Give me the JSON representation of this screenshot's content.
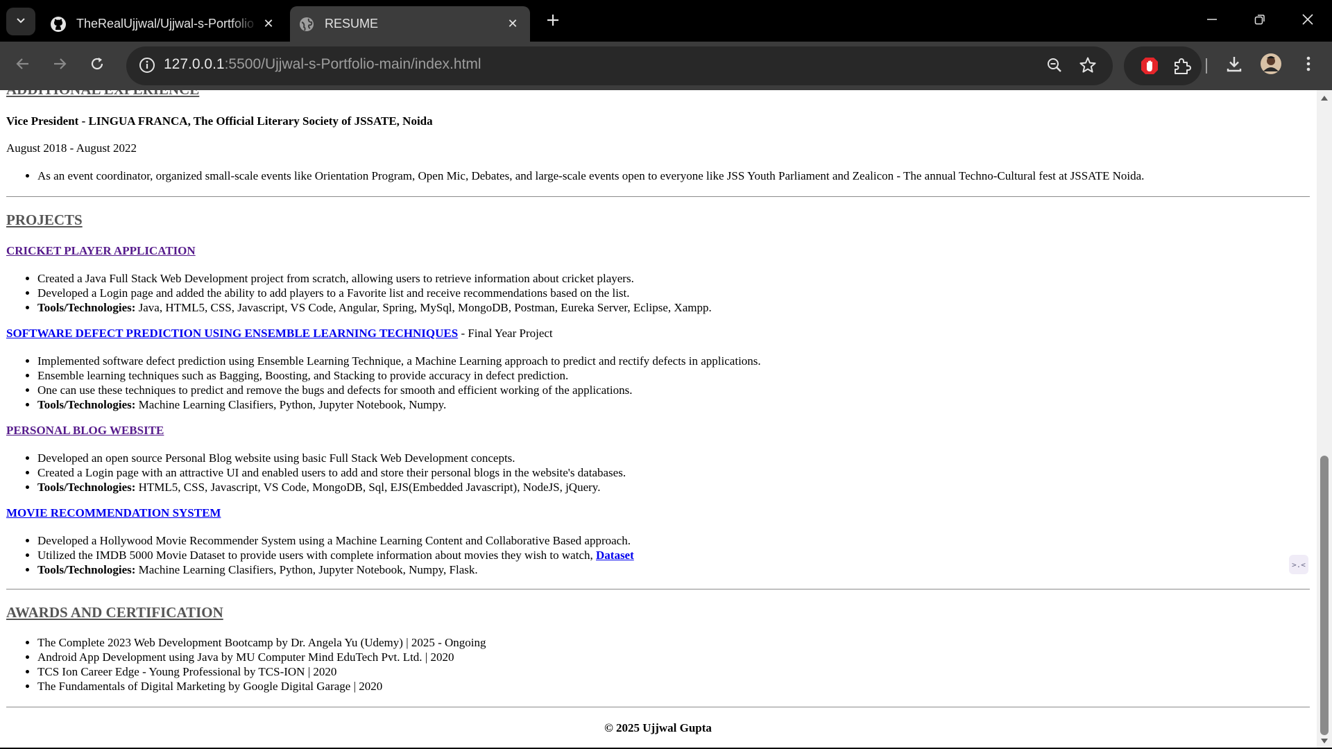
{
  "browser": {
    "tabs": [
      {
        "title": "TheRealUjjwal/Ujjwal-s-Portfolio",
        "favicon": "github-icon",
        "active": false
      },
      {
        "title": "RESUME",
        "favicon": "globe-icon",
        "active": true
      }
    ],
    "url_host": "127.0.0.1",
    "url_rest": ":5500/Ujjwal-s-Portfolio-main/index.html"
  },
  "page": {
    "additional_experience": {
      "heading": "ADDITIONAL EXPERIENCE",
      "role": "Vice President - LINGUA FRANCA, The Official Literary Society of JSSATE, Noida",
      "dates": "August 2018 - August 2022",
      "bullets": [
        "As an event coordinator, organized small-scale events like Orientation Program, Open Mic, Debates, and large-scale events open to everyone like JSS Youth Parliament and Zealicon - The annual Techno-Cultural fest at JSSATE Noida."
      ]
    },
    "projects": {
      "heading": "PROJECTS",
      "tools_label": "Tools/Technologies:",
      "items": [
        {
          "title": "CRICKET PLAYER APPLICATION",
          "suffix": "",
          "bullets": [
            "Created a Java Full Stack Web Development project from scratch, allowing users to retrieve information about cricket players.",
            "Developed a Login page and added the ability to add players to a Favorite list and receive recommendations based on the list."
          ],
          "tools": "Java, HTML5, CSS, Javascript, VS Code, Angular, Spring, MySql, MongoDB, Postman, Eureka Server, Eclipse, Xampp."
        },
        {
          "title": "SOFTWARE DEFECT PREDICTION USING ENSEMBLE LEARNING TECHNIQUES",
          "suffix": " - Final Year Project",
          "bullets": [
            "Implemented software defect prediction using Ensemble Learning Technique, a Machine Learning approach to predict and rectify defects in applications.",
            "Ensemble learning techniques such as Bagging, Boosting, and Stacking to provide accuracy in defect prediction.",
            "One can use these techniques to predict and remove the bugs and defects for smooth and efficient working of the applications."
          ],
          "tools": "Machine Learning Clasifiers, Python, Jupyter Notebook, Numpy."
        },
        {
          "title": "PERSONAL BLOG WEBSITE",
          "suffix": "",
          "bullets": [
            "Developed an open source Personal Blog website using basic Full Stack Web Development concepts.",
            "Created a Login page with an attractive UI and enabled users to add and store their personal blogs in the website's databases."
          ],
          "tools": "HTML5, CSS, Javascript, VS Code, MongoDB, Sql, EJS(Embedded Javascript), NodeJS, jQuery."
        },
        {
          "title": "MOVIE RECOMMENDATION SYSTEM",
          "suffix": "",
          "bullets": [
            "Developed a Hollywood Movie Recommender System using a Machine Learning Content and Collaborative Based approach.",
            "Utilized the IMDB 5000 Movie Dataset to provide users with complete information about movies they wish to watch, "
          ],
          "dataset_link": "Dataset",
          "tools": "Machine Learning Clasifiers, Python, Jupyter Notebook, Numpy, Flask."
        }
      ]
    },
    "awards": {
      "heading": "AWARDS AND CERTIFICATION",
      "items": [
        "The Complete 2023 Web Development Bootcamp by Dr. Angela Yu (Udemy) | 2025 - Ongoing",
        "Android App Development using Java by MU Computer Mind EduTech Pvt. Ltd. | 2020",
        "TCS Ion Career Edge - Young Professional by TCS-ION | 2020",
        "The Fundamentals of Digital Marketing by Google Digital Garage | 2020"
      ]
    },
    "footer": "© 2025 Ujjwal Gupta",
    "widget_glyph": ">.<"
  }
}
